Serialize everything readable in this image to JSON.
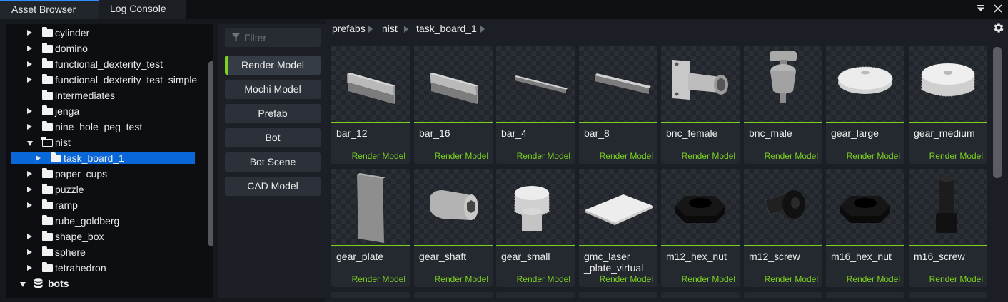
{
  "tabs": [
    {
      "label": "Asset Browser",
      "active": true
    },
    {
      "label": "Log Console",
      "active": false
    }
  ],
  "window_controls": {
    "menu_icon": "dropdown-menu-icon",
    "close_icon": "close-icon"
  },
  "tree": {
    "items": [
      {
        "label": "cylinder",
        "expanded": false,
        "icon": "folder-icon"
      },
      {
        "label": "domino",
        "expanded": false,
        "icon": "folder-icon"
      },
      {
        "label": "functional_dexterity_test",
        "expanded": false,
        "icon": "folder-icon"
      },
      {
        "label": "functional_dexterity_test_simple",
        "expanded": false,
        "icon": "folder-icon"
      },
      {
        "label": "intermediates",
        "expanded": null,
        "icon": "folder-icon"
      },
      {
        "label": "jenga",
        "expanded": false,
        "icon": "folder-icon"
      },
      {
        "label": "nine_hole_peg_test",
        "expanded": false,
        "icon": "folder-icon"
      },
      {
        "label": "nist",
        "expanded": true,
        "icon": "folder-open-icon"
      },
      {
        "label": "task_board_1",
        "expanded": false,
        "icon": "folder-icon",
        "selected": true
      },
      {
        "label": "paper_cups",
        "expanded": false,
        "icon": "folder-icon"
      },
      {
        "label": "puzzle",
        "expanded": false,
        "icon": "folder-icon"
      },
      {
        "label": "ramp",
        "expanded": false,
        "icon": "folder-icon"
      },
      {
        "label": "rube_goldberg",
        "expanded": null,
        "icon": "folder-icon"
      },
      {
        "label": "shape_box",
        "expanded": false,
        "icon": "folder-icon"
      },
      {
        "label": "sphere",
        "expanded": false,
        "icon": "folder-icon"
      },
      {
        "label": "tetrahedron",
        "expanded": false,
        "icon": "folder-icon"
      },
      {
        "label": "bots",
        "expanded": true,
        "icon": "database-icon",
        "bold": true
      }
    ]
  },
  "filter": {
    "placeholder": "Filter",
    "types": [
      {
        "label": "Render Model",
        "active": true
      },
      {
        "label": "Mochi Model",
        "active": false
      },
      {
        "label": "Prefab",
        "active": false
      },
      {
        "label": "Bot",
        "active": false
      },
      {
        "label": "Bot Scene",
        "active": false
      },
      {
        "label": "CAD Model",
        "active": false
      }
    ]
  },
  "breadcrumb": [
    "prefabs",
    "nist",
    "task_board_1"
  ],
  "assets": [
    {
      "name": "bar_12",
      "type": "Render Model",
      "shape": "bar-thick"
    },
    {
      "name": "bar_16",
      "type": "Render Model",
      "shape": "bar-thick"
    },
    {
      "name": "bar_4",
      "type": "Render Model",
      "shape": "bar-thin"
    },
    {
      "name": "bar_8",
      "type": "Render Model",
      "shape": "bar-medium"
    },
    {
      "name": "bnc_female",
      "type": "Render Model",
      "shape": "bnc-female"
    },
    {
      "name": "bnc_male",
      "type": "Render Model",
      "shape": "bnc-male"
    },
    {
      "name": "gear_large",
      "type": "Render Model",
      "shape": "gear-flat"
    },
    {
      "name": "gear_medium",
      "type": "Render Model",
      "shape": "gear-thick"
    },
    {
      "name": "gear_plate",
      "type": "Render Model",
      "shape": "plate-vertical"
    },
    {
      "name": "gear_shaft",
      "type": "Render Model",
      "shape": "shaft"
    },
    {
      "name": "gear_small",
      "type": "Render Model",
      "shape": "gear-small"
    },
    {
      "name": "gmc_laser_plate_virtual",
      "display_lines": [
        "gmc_laser",
        "_plate_virtual"
      ],
      "type": "Render Model",
      "shape": "plate-flat"
    },
    {
      "name": "m12_hex_nut",
      "type": "Render Model",
      "shape": "hex-nut"
    },
    {
      "name": "m12_screw",
      "type": "Render Model",
      "shape": "screw-side"
    },
    {
      "name": "m16_hex_nut",
      "type": "Render Model",
      "shape": "hex-nut"
    },
    {
      "name": "m16_screw",
      "type": "Render Model",
      "shape": "screw-up"
    }
  ],
  "settings_icon": "gear-icon",
  "colors": {
    "accent_green": "#7ed321",
    "selection_blue": "#0a67d8",
    "tab_active_border": "#2f8cff"
  }
}
